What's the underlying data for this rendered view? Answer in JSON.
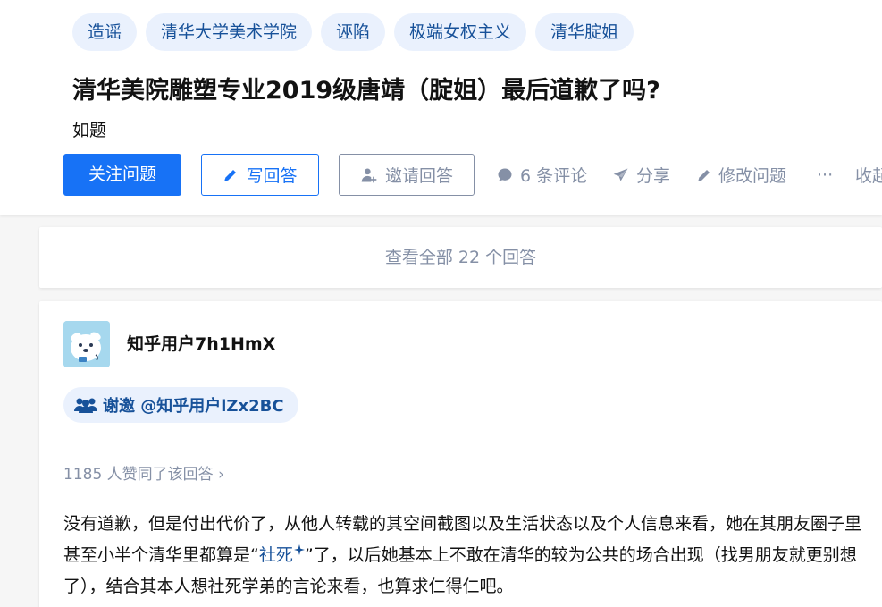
{
  "topics": [
    "造谣",
    "清华大学美术学院",
    "诬陷",
    "极端女权主义",
    "清华腚姐"
  ],
  "question": {
    "title": "清华美院雕塑专业2019级唐靖（腚姐）最后道歉了吗?",
    "detail": "如题"
  },
  "actions": {
    "follow": "关注问题",
    "write": "写回答",
    "invite": "邀请回答",
    "comments": "6 条评论",
    "share": "分享",
    "edit": "修改问题",
    "more": "···",
    "collapse": "收起"
  },
  "view_all": "查看全部 22 个回答",
  "answer": {
    "author": "知乎用户7h1HmX",
    "invite_text": "谢邀 @知乎用户lZx2BC",
    "votes": "1185 人赞同了该回答 ›",
    "content": {
      "before": "没有道歉，但是付出代价了，从他人转载的其空间截图以及生活状态以及个人信息来看，她在其朋友圈子里甚至小半个清华里都算是“",
      "link": "社死",
      "after": "”了，以后她基本上不敢在清华的较为公共的场合出现（找男朋友就更别想了），结合其本人想社死学弟的言论来看，也算求仁得仁吧。"
    }
  },
  "colors": {
    "brand": "#1772f6",
    "tag_bg": "#eaf1fd",
    "tag_text": "#175199",
    "muted": "#8590a6"
  },
  "icons": [
    "pencil-icon",
    "invite-user-icon",
    "comment-icon",
    "share-icon",
    "edit-icon",
    "more-icon",
    "group-icon",
    "sparkle-icon"
  ]
}
